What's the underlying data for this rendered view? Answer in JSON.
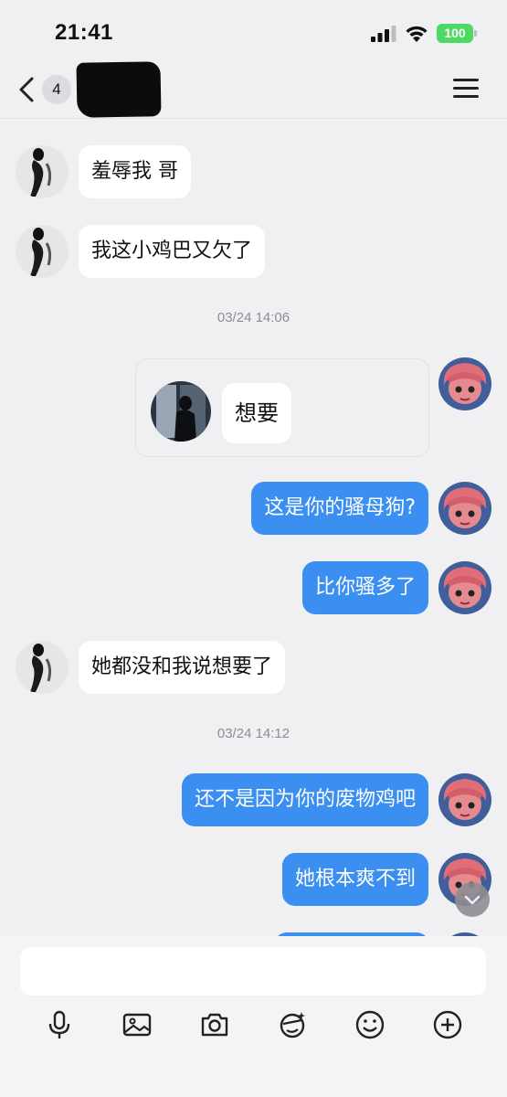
{
  "status_bar": {
    "time": "21:41",
    "battery": "100"
  },
  "nav": {
    "unread_count": "4"
  },
  "messages": [
    {
      "side": "in",
      "text": "羞辱我 哥"
    },
    {
      "side": "in",
      "text": "我这小鸡巴又欠了"
    },
    {
      "type": "time",
      "text": "03/24 14:06"
    },
    {
      "type": "card",
      "side": "out",
      "text": "想要"
    },
    {
      "side": "out",
      "text": "这是你的骚母狗?"
    },
    {
      "side": "out",
      "text": "比你骚多了"
    },
    {
      "side": "in",
      "text": "她都没和我说想要了"
    },
    {
      "type": "time",
      "text": "03/24 14:12"
    },
    {
      "side": "out",
      "text": "还不是因为你的废物鸡吧"
    },
    {
      "side": "out",
      "text": "她根本爽不到"
    }
  ],
  "input": {
    "value": "",
    "placeholder": ""
  },
  "toolbar": [
    "microphone-icon",
    "image-icon",
    "camera-icon",
    "sticker-icon",
    "emoji-icon",
    "plus-icon"
  ],
  "colors": {
    "outgoing_bubble": "#3b8ff0",
    "incoming_bubble": "#ffffff",
    "background": "#f0f0f2",
    "battery": "#4cd964"
  }
}
